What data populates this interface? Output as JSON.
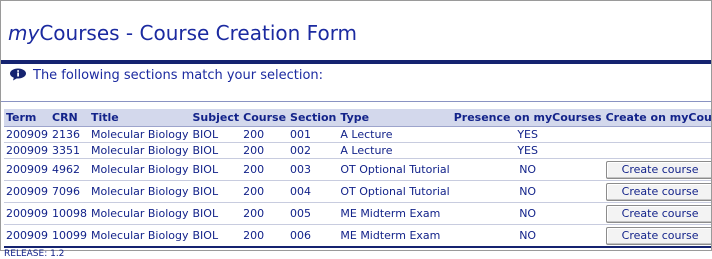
{
  "page": {
    "title_prefix": "my",
    "title_rest": "Courses - Course Creation Form",
    "notice": "The following sections match your selection:",
    "notice_icon": "info-icon",
    "release": "RELEASE: 1.2"
  },
  "table": {
    "headers": [
      "Term",
      "CRN",
      "Title",
      "Subject",
      "Course",
      "Section",
      "Type",
      "Presence on myCourses",
      "Create on myCour"
    ],
    "button_label": "Create course",
    "rows": [
      {
        "term": "200909",
        "crn": "2136",
        "title": "Molecular Biology",
        "subject": "BIOL",
        "course": "200",
        "section": "001",
        "type": "A Lecture",
        "presence": "YES",
        "create": false
      },
      {
        "term": "200909",
        "crn": "3351",
        "title": "Molecular Biology",
        "subject": "BIOL",
        "course": "200",
        "section": "002",
        "type": "A Lecture",
        "presence": "YES",
        "create": false
      },
      {
        "term": "200909",
        "crn": "4962",
        "title": "Molecular Biology",
        "subject": "BIOL",
        "course": "200",
        "section": "003",
        "type": "OT Optional Tutorial",
        "presence": "NO",
        "create": true
      },
      {
        "term": "200909",
        "crn": "7096",
        "title": "Molecular Biology",
        "subject": "BIOL",
        "course": "200",
        "section": "004",
        "type": "OT Optional Tutorial",
        "presence": "NO",
        "create": true
      },
      {
        "term": "200909",
        "crn": "10098",
        "title": "Molecular Biology",
        "subject": "BIOL",
        "course": "200",
        "section": "005",
        "type": "ME Midterm Exam",
        "presence": "NO",
        "create": true
      },
      {
        "term": "200909",
        "crn": "10099",
        "title": "Molecular Biology",
        "subject": "BIOL",
        "course": "200",
        "section": "006",
        "type": "ME Midterm Exam",
        "presence": "NO",
        "create": true
      }
    ]
  },
  "colors": {
    "text": "#13238a",
    "header_bg": "#d3d8ec",
    "rule": "#152370"
  }
}
